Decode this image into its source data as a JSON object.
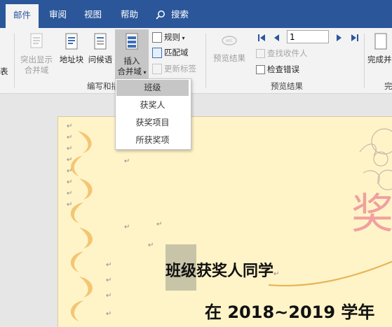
{
  "tabs": [
    {
      "label": "邮件",
      "active": true
    },
    {
      "label": "审阅"
    },
    {
      "label": "视图"
    },
    {
      "label": "帮助"
    }
  ],
  "search_label": "搜索",
  "ribbon": {
    "left_fragment": "表",
    "highlight_fields": "突出显示\n合并域",
    "address_block": "地址块",
    "greeting_line": "问候语",
    "insert_merge_field_line1": "插入",
    "insert_merge_field_line2": "合并域",
    "rules": "规则",
    "match_fields": "匹配域",
    "update_labels": "更新标签",
    "preview_results": "预览结果",
    "record_number": "1",
    "find_recipient": "查找收件人",
    "check_errors": "检查错误",
    "finish_fragment": "完成并",
    "group_write_insert": "编写和插",
    "group_preview": "预览结果",
    "group_finish_fragment": "完"
  },
  "dropdown": {
    "items": [
      "班级",
      "获奖人",
      "获奖项目",
      "所获奖项"
    ],
    "selected_index": 0
  },
  "document": {
    "merge_field_class": "班级",
    "line1_rest": "获奖人同学",
    "line2": "在 2018~2019 学年",
    "award_glyph": "奖",
    "para_mark": "↵"
  },
  "colors": {
    "accent": "#2b579a",
    "page_background": "#fff4c8",
    "ornament": "#f2c26a",
    "award_text": "#f0a0a0",
    "merge_field_highlight": "#c8c4a8"
  }
}
